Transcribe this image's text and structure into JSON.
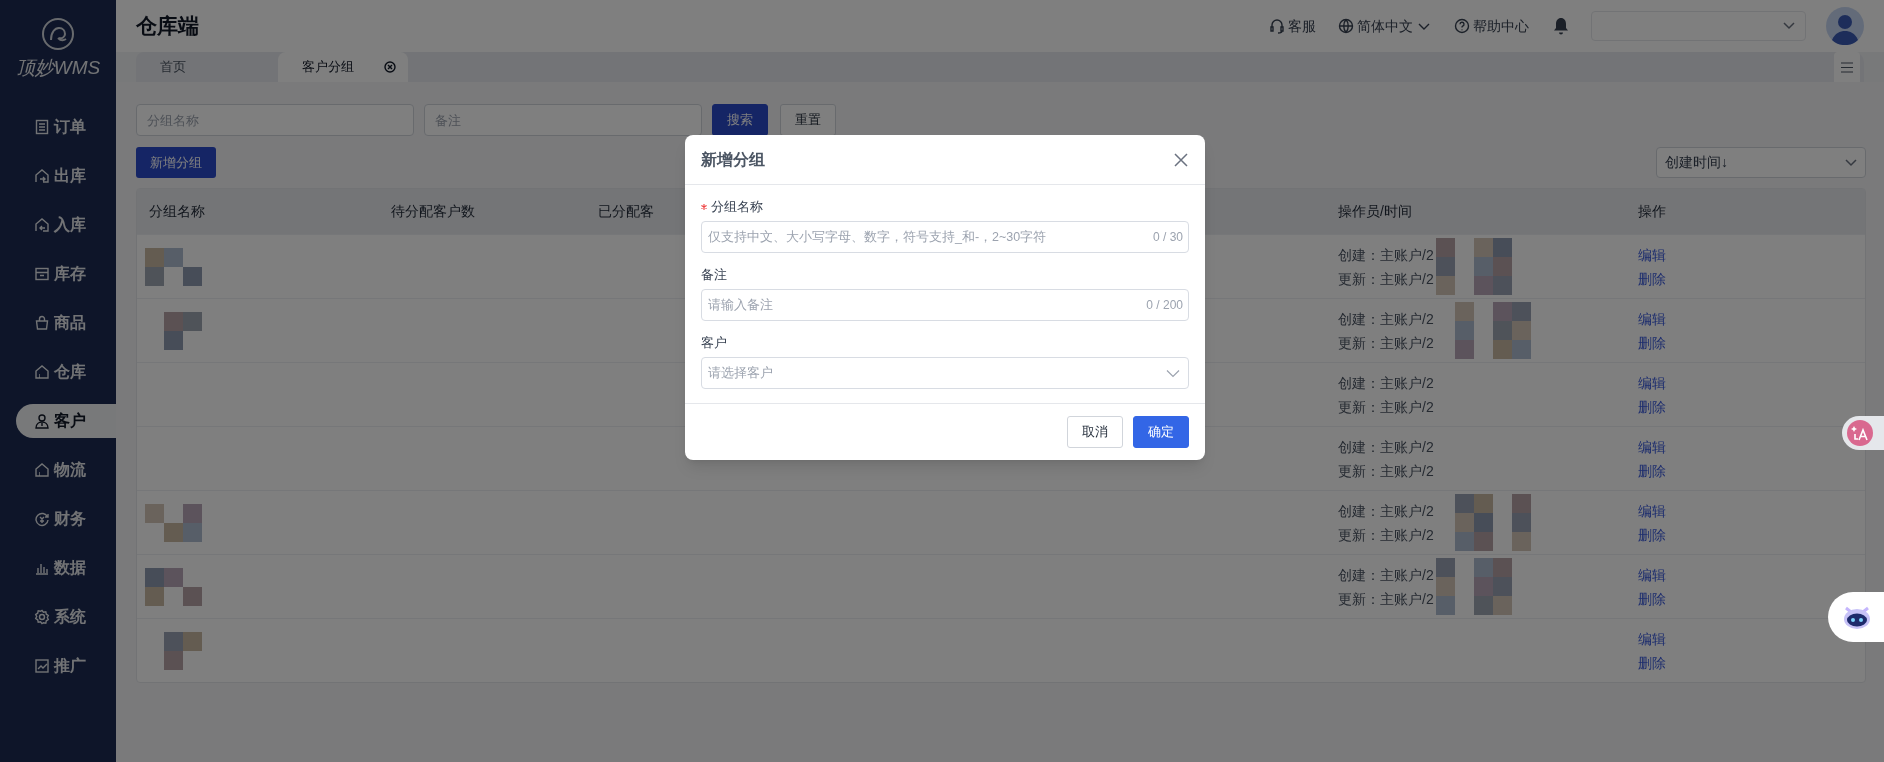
{
  "sidebar": {
    "logo": "顶妙WMS",
    "items": [
      {
        "label": "订单",
        "selected": false
      },
      {
        "label": "出库",
        "selected": false
      },
      {
        "label": "入库",
        "selected": false
      },
      {
        "label": "库存",
        "selected": false
      },
      {
        "label": "商品",
        "selected": false
      },
      {
        "label": "仓库",
        "selected": false
      },
      {
        "label": "客户",
        "selected": true
      },
      {
        "label": "物流",
        "selected": false
      },
      {
        "label": "财务",
        "selected": false
      },
      {
        "label": "数据",
        "selected": false
      },
      {
        "label": "系统",
        "selected": false
      },
      {
        "label": "推广",
        "selected": false
      }
    ]
  },
  "header": {
    "title": "仓库端",
    "links": [
      {
        "label": "客服"
      },
      {
        "label": "简体中文"
      },
      {
        "label": "帮助中心"
      }
    ]
  },
  "tabs": [
    {
      "label": "首页",
      "selected": false,
      "closable": false
    },
    {
      "label": "客户分组",
      "selected": true,
      "closable": true
    }
  ],
  "filters": {
    "fields": [
      {
        "placeholder": "分组名称"
      },
      {
        "placeholder": "备注"
      }
    ],
    "buttons": [
      {
        "label": "搜索",
        "kind": "primary"
      },
      {
        "label": "重置",
        "kind": "default"
      }
    ]
  },
  "toolbar": {
    "add_button": "新增分组",
    "sort": {
      "value": "创建时间↓"
    }
  },
  "table": {
    "columns": [
      "分组名称",
      "待分配客户数",
      "已分配客",
      "操作员/时间",
      "操作"
    ],
    "rows": [
      {
        "operator": [
          "创建：主账户/2",
          "更新：主账户/2"
        ],
        "actions": [
          "编辑",
          "删除"
        ]
      },
      {
        "operator": [
          "创建：主账户/2",
          "更新：主账户/2"
        ],
        "actions": [
          "编辑",
          "删除"
        ]
      },
      {
        "operator": [
          "创建：主账户/2",
          "更新：主账户/2"
        ],
        "actions": [
          "编辑",
          "删除"
        ]
      },
      {
        "operator": [
          "创建：主账户/2",
          "更新：主账户/2"
        ],
        "actions": [
          "编辑",
          "删除"
        ]
      },
      {
        "operator": [
          "创建：主账户/2",
          "更新：主账户/2"
        ],
        "actions": [
          "编辑",
          "删除"
        ]
      },
      {
        "operator": [
          "创建：主账户/2",
          "更新：主账户/2"
        ],
        "actions": [
          "编辑",
          "删除"
        ]
      },
      {
        "actions": [
          "编辑",
          "删除"
        ]
      }
    ]
  },
  "dialog": {
    "title": "新增分组",
    "fields": [
      {
        "kind": "input",
        "label": "分组名称",
        "required": true,
        "placeholder": "仅支持中文、大小写字母、数字，符号支持_和-，2~30字符",
        "counter": "0 / 30"
      },
      {
        "kind": "input",
        "label": "备注",
        "required": false,
        "placeholder": "请输入备注",
        "counter": "0 / 200"
      },
      {
        "kind": "select",
        "label": "客户",
        "required": false,
        "placeholder": "请选择客户"
      }
    ],
    "buttons": [
      {
        "label": "取消",
        "kind": "default"
      },
      {
        "label": "确定",
        "kind": "primary"
      }
    ]
  }
}
